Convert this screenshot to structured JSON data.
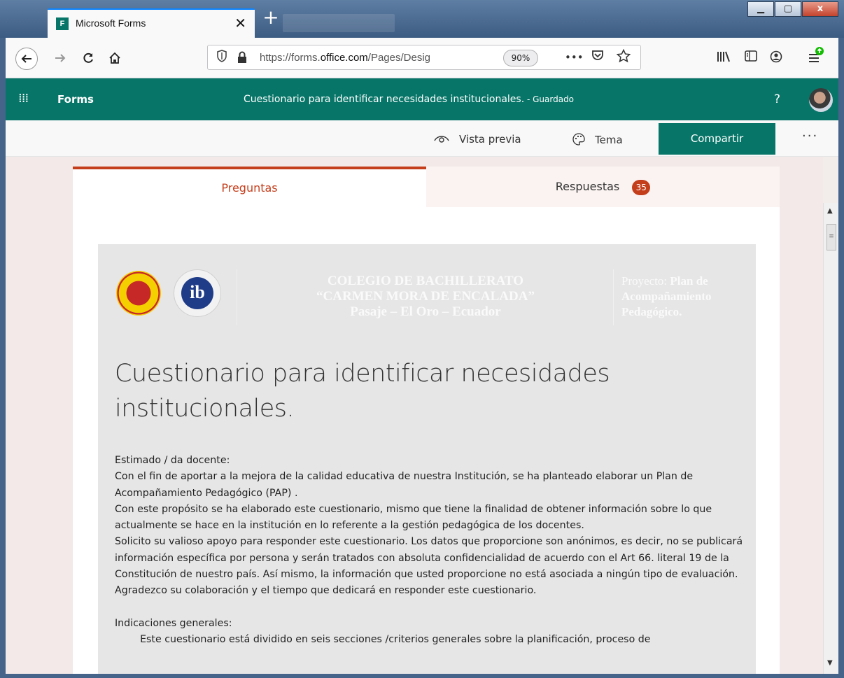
{
  "browser": {
    "tab_title": "Microsoft Forms",
    "tab_close": "✕",
    "new_tab": "+",
    "url_prefix": "https://forms.",
    "url_domain": "office.com",
    "url_path": "/Pages/Desig",
    "zoom": "90%",
    "page_actions": "•••",
    "window_minimize": "▁",
    "window_maximize": "▢",
    "window_close": "x"
  },
  "forms_header": {
    "waffle": "⁞⁞⁞",
    "brand": "Forms",
    "doc_title": "Cuestionario para identificar necesidades institucionales.",
    "doc_status": " - Guardado",
    "help": "?"
  },
  "command_bar": {
    "preview_label": "Vista previa",
    "theme_label": "Tema",
    "share_label": "Compartir",
    "more_label": "···"
  },
  "tabs": {
    "questions_label": "Preguntas",
    "responses_label": "Respuestas",
    "responses_count": "35"
  },
  "form": {
    "school_line1": "COLEGIO DE BACHILLERATO",
    "school_line2": "“CARMEN MORA DE ENCALADA”",
    "school_line3": "Pasaje – El Oro – Ecuador",
    "project_label": "Proyecto:",
    "project_name": "Plan de Acompañamiento Pedagógico.",
    "ib_logo_text": "ib",
    "title": "Cuestionario para identificar necesidades institucionales.",
    "description": [
      "Estimado / da docente:",
      "Con el fin de aportar a la mejora de la calidad educativa de nuestra Institución, se ha planteado elaborar un Plan de Acompañamiento Pedagógico (PAP) .",
      "Con este propósito se ha elaborado este cuestionario, mismo que tiene la finalidad de obtener información sobre lo que actualmente se hace en la institución en lo referente a la gestión pedagógica de los docentes.",
      "Solicito su valioso apoyo para responder este cuestionario. Los datos que proporcione son anónimos, es decir, no se publicará información específica por persona y serán tratados con absoluta confidencialidad de acuerdo con el Art 66. literal 19  de la Constitución de nuestro país. Así mismo, la información que usted proporcione no está asociada a ningún tipo de evaluación.",
      "Agradezco su colaboración y el tiempo que dedicará en responder este cuestionario.",
      "",
      "Indicaciones generales:",
      "        Este cuestionario está dividido en seis secciones /criterios generales sobre la planificación, proceso de"
    ]
  },
  "colors": {
    "forms_green": "#077568",
    "accent_orange": "#c43e1c",
    "title_bar": "#4d6d94"
  }
}
